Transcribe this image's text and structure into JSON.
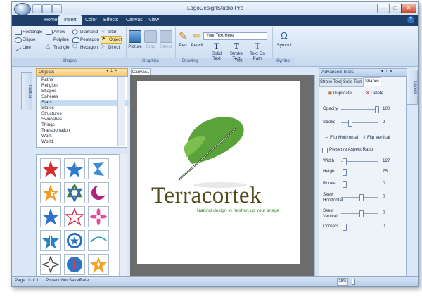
{
  "window": {
    "title": "LogoDesignStudio Pro"
  },
  "tabs": [
    {
      "label": "Home"
    },
    {
      "label": "Insert"
    },
    {
      "label": "Color"
    },
    {
      "label": "Effects"
    },
    {
      "label": "Canvas"
    },
    {
      "label": "View"
    }
  ],
  "active_tab": "Insert",
  "ribbon": {
    "shapes": {
      "label": "Shapes",
      "items": [
        "Rectangle",
        "Arrow",
        "Diamond",
        "Star",
        "Ellipse",
        "Polyline",
        "Pentagon",
        "Object",
        "Line",
        "Triangle",
        "Hexagon",
        "Direct"
      ],
      "selected": "Object"
    },
    "graphics": {
      "label": "Graphics",
      "items": [
        "Picture",
        "Crop",
        "Select"
      ]
    },
    "drawing": {
      "label": "Drawing",
      "items": [
        "Pen",
        "Pencil"
      ]
    },
    "text": {
      "label": "Text",
      "input_value": "Your Text Here",
      "items": [
        "Solid Text",
        "Stroke Text",
        "Text On Path"
      ]
    },
    "symbol": {
      "label": "Symbol",
      "items": [
        "Symbol"
      ]
    }
  },
  "objects_panel": {
    "title": "Objects",
    "pin_icon": "pin-icon",
    "close_label": "✕",
    "side_tab": "Toolbar",
    "categories": [
      "Paths",
      "Religion",
      "Shapes",
      "Spheres",
      "Stars",
      "States",
      "Structures",
      "Swooshes",
      "Things",
      "Transportation",
      "Work",
      "World"
    ],
    "selected": "Stars"
  },
  "canvas": {
    "tab_label": "Canvas1",
    "logo_name": "Terracortek",
    "logo_tagline": "Natural design to freshen up your image",
    "colors": {
      "leaf": "#5aa33a",
      "name": "#4f4a1a",
      "tagline": "#2c8a1e"
    }
  },
  "tools_panel": {
    "title": "Advanced Tools",
    "side_tab": "Layers",
    "tabs": [
      "Stroke Text",
      "Solid Text",
      "Shapes"
    ],
    "active_tab": "Shapes",
    "duplicate_label": "Duplicate",
    "delete_label": "Delete",
    "opacity": {
      "label": "Opacity",
      "value": "100",
      "level": 1.0
    },
    "stroke": {
      "label": "Stroke",
      "value": "2",
      "level": 0.2
    },
    "flip_h_label": "Flip Horizontal",
    "flip_v_label": "Flip Vertical",
    "preserve_label": "Preserve Aspect Ratio",
    "width": {
      "label": "Width",
      "value": "127",
      "level": 0.05
    },
    "height": {
      "label": "Height",
      "value": "75",
      "level": 0.05
    },
    "rotate": {
      "label": "Rotate",
      "value": "0",
      "level": 0.05
    },
    "skew_h": {
      "label": "Skew\nHorizontal",
      "value": "0",
      "level": 0.55
    },
    "skew_v": {
      "label": "Skew\nVertical",
      "value": "0",
      "level": 0.55
    },
    "corners": {
      "label": "Corners",
      "value": "0",
      "level": 0.05
    }
  },
  "statusbar": {
    "page": "Page: 1 of 1",
    "saved": "Project Not Saved",
    "date": "Date",
    "zoom": "28%"
  }
}
